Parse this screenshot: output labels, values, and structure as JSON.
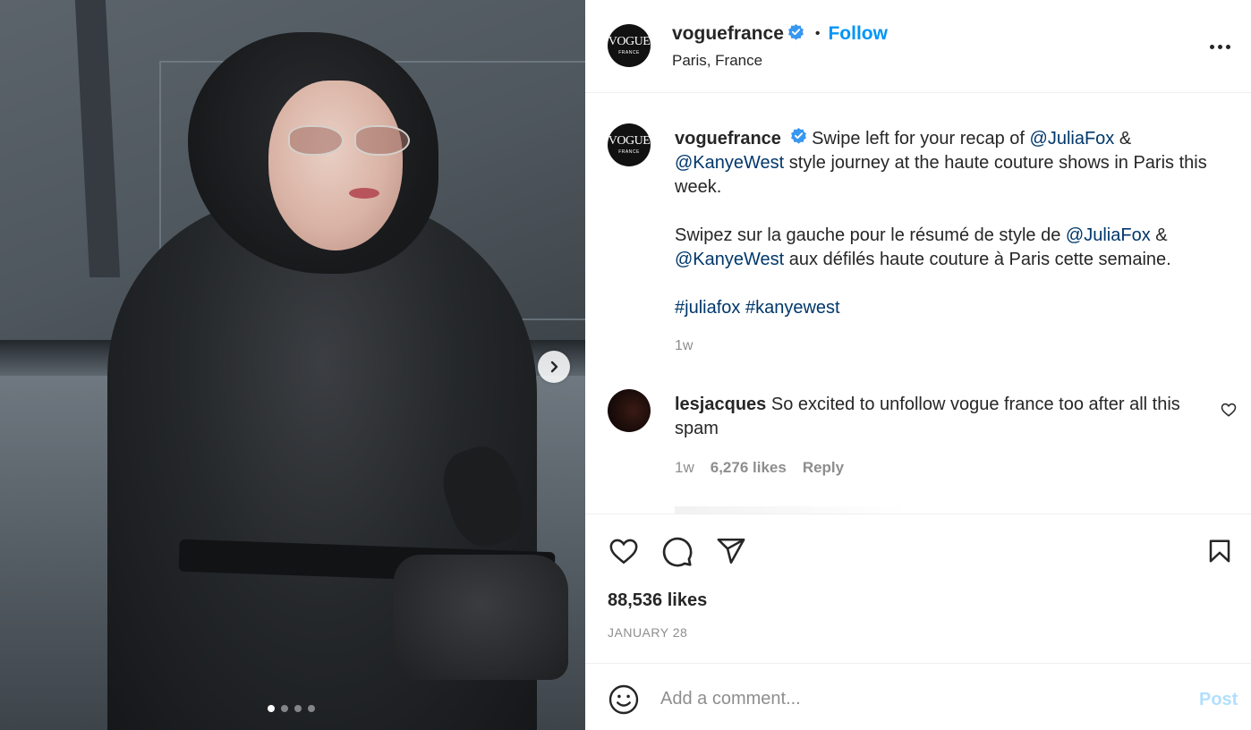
{
  "post": {
    "author": "voguefrance",
    "avatar_line1": "VOGUE",
    "avatar_line2": "FRANCE",
    "separator": "•",
    "follow_label": "Follow",
    "location": "Paris, France",
    "carousel": {
      "slide_count": 4,
      "active_index": 0
    }
  },
  "caption": {
    "author": "voguefrance",
    "p1_text1": "Swipe left for your recap of",
    "p1_mention1": "@JuliaFox",
    "p1_amp": "&",
    "p1_mention2": "@KanyeWest",
    "p1_text2": "style journey at the haute couture shows in Paris this week.",
    "p2_text1": "Swipez sur la gauche pour le résumé de style de",
    "p2_mention1": "@JuliaFox",
    "p2_amp": "&",
    "p2_mention2": "@KanyeWest",
    "p2_text2": "aux défilés haute couture à Paris cette semaine.",
    "hashtag1": "#juliafox",
    "hashtag2": "#kanyewest",
    "time": "1w"
  },
  "comments": [
    {
      "user": "lesjacques",
      "text": "So excited to unfollow vogue france too after all this spam",
      "time": "1w",
      "likes": "6,276 likes",
      "reply_label": "Reply"
    }
  ],
  "actions": {
    "likes": "88,536 likes",
    "date": "JANUARY 28",
    "icons": [
      "heart-icon",
      "comment-icon",
      "share-icon",
      "bookmark-icon"
    ]
  },
  "add_comment": {
    "placeholder": "Add a comment...",
    "post_label": "Post"
  },
  "colors": {
    "accent": "#0095f6",
    "mention": "#00376b",
    "muted": "#8e8e8e",
    "post_disabled": "#b2dffc",
    "verified": "#3897f0"
  }
}
